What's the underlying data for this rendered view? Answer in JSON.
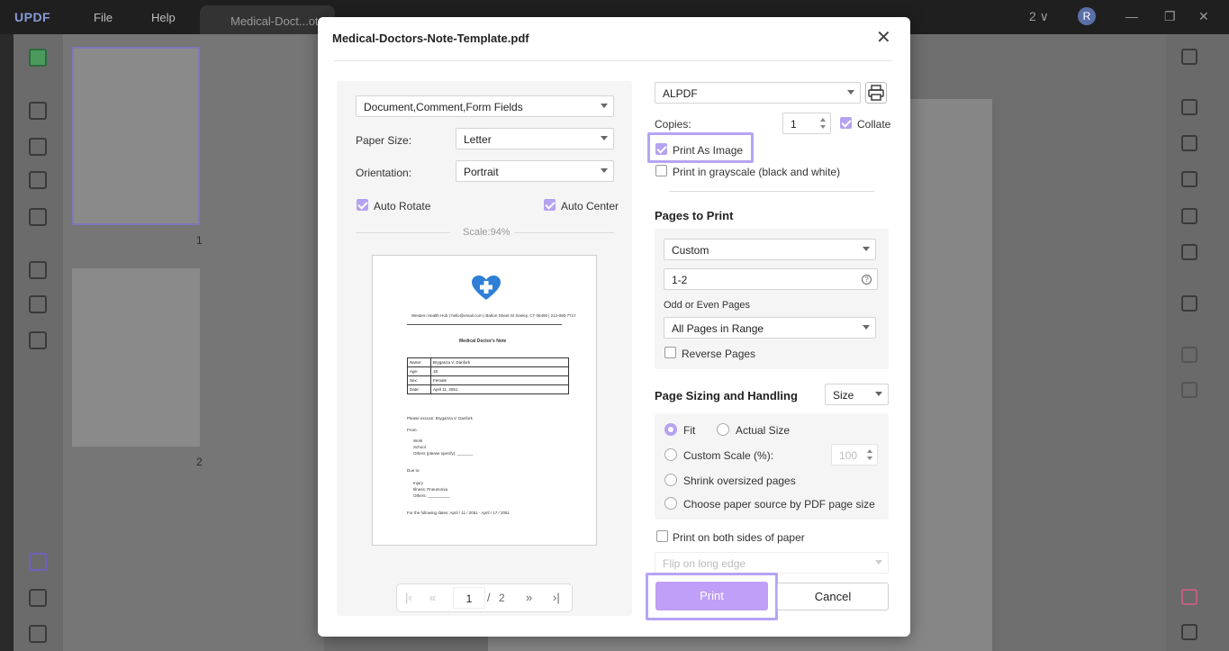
{
  "app": {
    "logo": "UPDF",
    "menu": [
      "File",
      "Help"
    ],
    "tab_title": "Medical-Doct...ote",
    "page_counter": "2 ∨",
    "avatar_initial": "R",
    "thumbnails": [
      "1",
      "2"
    ]
  },
  "dialog": {
    "title": "Medical-Doctors-Note-Template.pdf",
    "content_select": "Document,Comment,Form Fields",
    "paper_size_label": "Paper Size:",
    "paper_size": "Letter",
    "orientation_label": "Orientation:",
    "orientation": "Portrait",
    "auto_rotate": "Auto Rotate",
    "auto_center": "Auto Center",
    "scale": "Scale:94%",
    "pager": {
      "current": "1",
      "sep": "/",
      "total": "2"
    },
    "printer": "ALPDF",
    "copies_label": "Copies:",
    "copies": "1",
    "collate": "Collate",
    "print_as_image": "Print As Image",
    "grayscale": "Print in grayscale (black and white)",
    "pages_to_print": {
      "title": "Pages to Print",
      "mode": "Custom",
      "range": "1-2",
      "odd_even_label": "Odd or Even Pages",
      "odd_even": "All Pages in Range",
      "reverse": "Reverse Pages"
    },
    "sizing": {
      "title": "Page Sizing and Handling",
      "mode": "Size",
      "fit": "Fit",
      "actual": "Actual Size",
      "custom_scale": "Custom Scale (%):",
      "custom_value": "100",
      "shrink": "Shrink oversized pages",
      "paper_source": "Choose paper source by PDF page size"
    },
    "duplex": "Print on both sides of paper",
    "flip": "Flip on long edge",
    "print_btn": "Print",
    "cancel_btn": "Cancel"
  },
  "preview": {
    "header_line": "Western Health Hub | hello@email.com | Batton Street St Seeley, CT 06490 | 212-090-7717",
    "doc_title": "Medical Doctor's Note",
    "rows": [
      [
        "Name:",
        "Bryganza V. Danfork"
      ],
      [
        "Age:",
        "18"
      ],
      [
        "Sex:",
        "Female"
      ],
      [
        "Date:",
        "April 11, 2051"
      ]
    ],
    "excuse": "Please excuse: Bryganza V. Danfork",
    "from_label": "From:",
    "from_items": [
      "Work",
      "School",
      "Others (please specify): _______"
    ],
    "due_label": "Due to:",
    "due_items": [
      "Injury",
      "Illness: Pneumonia",
      "Others: __________"
    ],
    "dates": "For the following dates: April / 11 / 2051 - April / 17 / 2051"
  },
  "colors": {
    "accent": "#b5a2f0",
    "print_button": "#bf9ff7",
    "highlight": "#b6a4f5",
    "heart": "#2f7fd6"
  }
}
